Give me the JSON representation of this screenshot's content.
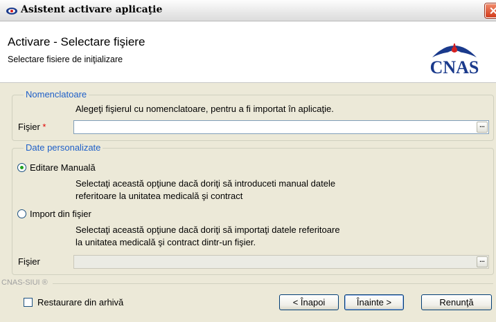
{
  "window": {
    "title": "Asistent activare aplicaţie",
    "close_glyph": "✕"
  },
  "header": {
    "title": "Activare - Selectare fişiere",
    "subtitle": "Selectare fisiere de iniţializare",
    "logo_text": "CNAS"
  },
  "nomenclatoare": {
    "legend": "Nomenclatoare",
    "description": "Alegeţi fişierul cu nomenclatoare, pentru a fi importat în aplicaţie.",
    "field_label": "Fişier",
    "required_marker": "*",
    "field_value": "",
    "browse_label": "..."
  },
  "date_personalizate": {
    "legend": "Date personalizate",
    "option_manual": {
      "label": "Editare Manuală",
      "selected": true,
      "description_line1": "Selectaţi această opţiune dacă doriţi să introduceti manual datele",
      "description_line2": "referitoare la unitatea medicală şi contract"
    },
    "option_import": {
      "label": "Import din fişier",
      "selected": false,
      "description_line1": "Selectaţi această opţiune dacă doriţi să importaţi datele referitoare",
      "description_line2": "la unitatea medicală şi contract dintr-un fişier."
    },
    "field_label": "Fişier",
    "field_value": "",
    "browse_label": "..."
  },
  "footer": {
    "brand": "CNAS-SIUI ®",
    "restore_checkbox_label": "Restaurare din arhivă",
    "restore_checked": false,
    "back_button": "< Înapoi",
    "next_button": "Înainte >",
    "cancel_button": "Renunţă"
  },
  "colors": {
    "accent_blue": "#1e5fc8",
    "required_red": "#e00000",
    "logo_blue": "#1a3a8c",
    "radio_green": "#21a121"
  },
  "icons": {
    "title_icon": "cnas-logo-icon",
    "close": "close-icon"
  }
}
